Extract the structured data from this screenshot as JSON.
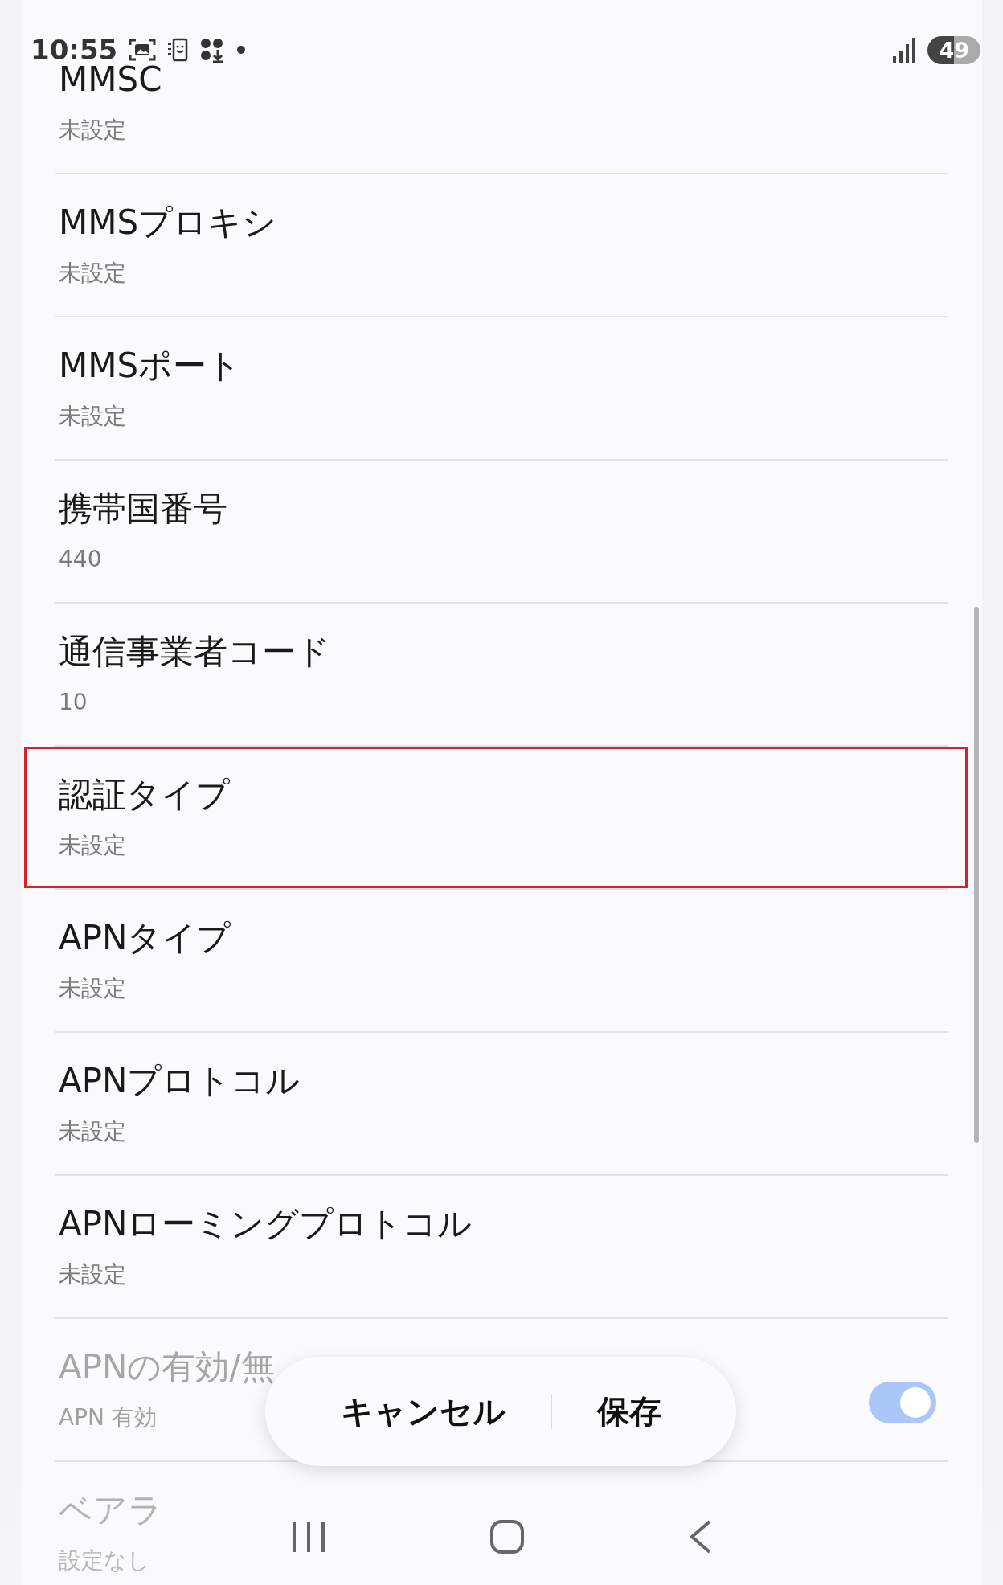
{
  "status_bar": {
    "time": "10:55",
    "battery": "49"
  },
  "settings": [
    {
      "title": "MMSC",
      "value": "未設定",
      "disabled": false,
      "highlighted": false
    },
    {
      "title": "MMSプロキシ",
      "value": "未設定",
      "disabled": false,
      "highlighted": false
    },
    {
      "title": "MMSポート",
      "value": "未設定",
      "disabled": false,
      "highlighted": false
    },
    {
      "title": "携帯国番号",
      "value": "440",
      "disabled": false,
      "highlighted": false
    },
    {
      "title": "通信事業者コード",
      "value": "10",
      "disabled": false,
      "highlighted": false
    },
    {
      "title": "認証タイプ",
      "value": "未設定",
      "disabled": false,
      "highlighted": true
    },
    {
      "title": "APNタイプ",
      "value": "未設定",
      "disabled": false,
      "highlighted": false
    },
    {
      "title": "APNプロトコル",
      "value": "未設定",
      "disabled": false,
      "highlighted": false
    },
    {
      "title": "APNローミングプロトコル",
      "value": "未設定",
      "disabled": false,
      "highlighted": false
    },
    {
      "title": "APNの有効/無",
      "value": "APN 有効",
      "disabled": true,
      "highlighted": false,
      "kind": "toggle",
      "on": true
    },
    {
      "title": "ベアラ",
      "value": "設定なし",
      "disabled": true,
      "highlighted": false
    }
  ],
  "actions": [
    "キャンセル",
    "保存"
  ]
}
